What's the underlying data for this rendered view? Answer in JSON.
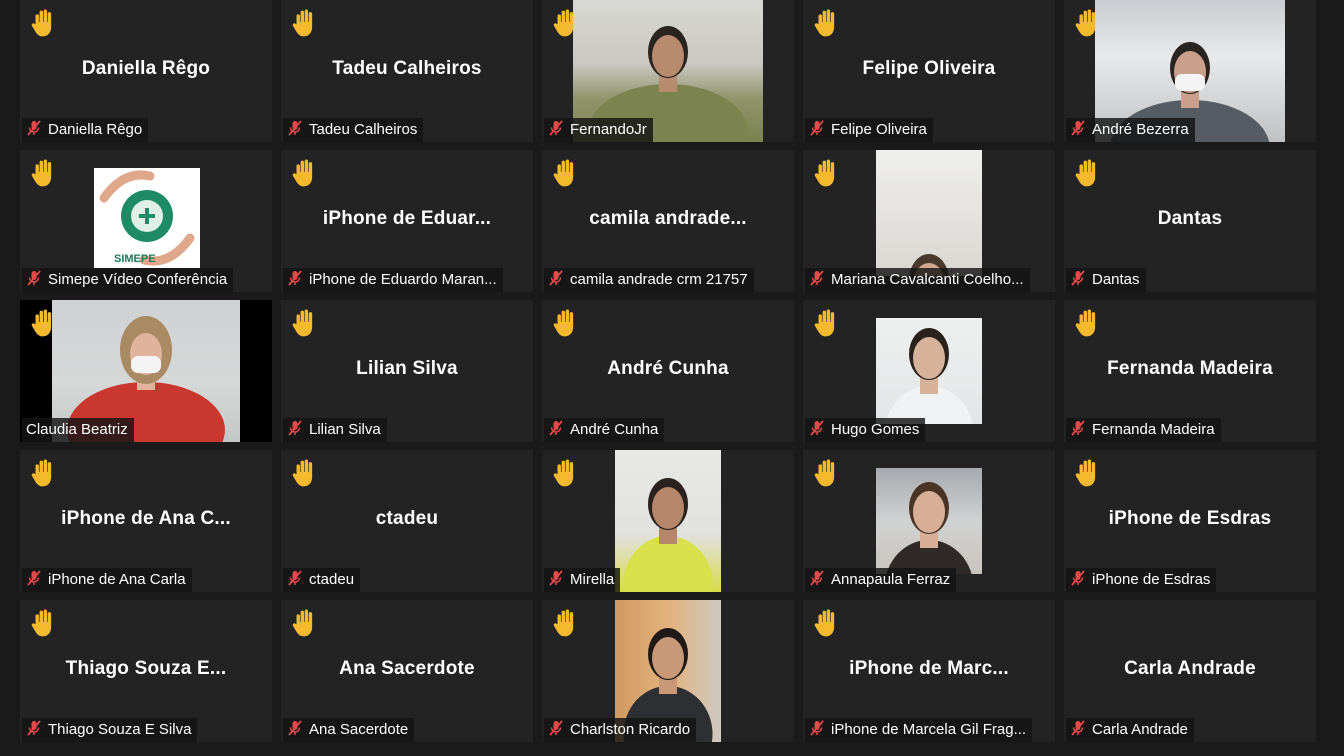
{
  "colors": {
    "tile_bg": "#232323",
    "active_border": "#d3e05a",
    "hand": "#f5b92e",
    "muted_mic": "#e34a4a"
  },
  "participants": [
    {
      "center": "Daniella Rêgo",
      "tag": "Daniella Rêgo",
      "raised_hand": true,
      "muted": true,
      "video": false
    },
    {
      "center": "Tadeu Calheiros",
      "tag": "Tadeu Calheiros",
      "raised_hand": true,
      "muted": true,
      "video": false
    },
    {
      "center": "",
      "tag": "FernandoJr",
      "raised_hand": true,
      "muted": true,
      "video": true
    },
    {
      "center": "Felipe Oliveira",
      "tag": "Felipe Oliveira",
      "raised_hand": true,
      "muted": true,
      "video": false
    },
    {
      "center": "",
      "tag": "André Bezerra",
      "raised_hand": true,
      "muted": true,
      "video": true
    },
    {
      "center": "",
      "tag": "Simepe Vídeo Conferência",
      "raised_hand": true,
      "muted": true,
      "video": true,
      "logo_text": "SIMEPE"
    },
    {
      "center": "iPhone de Eduar...",
      "tag": "iPhone de Eduardo Maran...",
      "raised_hand": true,
      "muted": true,
      "video": false
    },
    {
      "center": "camila andrade...",
      "tag": "camila andrade crm 21757",
      "raised_hand": true,
      "muted": true,
      "video": false
    },
    {
      "center": "",
      "tag": "Mariana Cavalcanti Coelho...",
      "raised_hand": true,
      "muted": true,
      "video": true
    },
    {
      "center": "Dantas",
      "tag": "Dantas",
      "raised_hand": true,
      "muted": true,
      "video": false
    },
    {
      "center": "",
      "tag": "Claudia Beatriz",
      "raised_hand": true,
      "muted": false,
      "video": true,
      "active_speaker": true
    },
    {
      "center": "Lilian Silva",
      "tag": "Lilian Silva",
      "raised_hand": true,
      "muted": true,
      "video": false
    },
    {
      "center": "André Cunha",
      "tag": "André Cunha",
      "raised_hand": true,
      "muted": true,
      "video": false
    },
    {
      "center": "",
      "tag": "Hugo Gomes",
      "raised_hand": true,
      "muted": true,
      "video": true
    },
    {
      "center": "Fernanda Madeira",
      "tag": "Fernanda Madeira",
      "raised_hand": true,
      "muted": true,
      "video": false
    },
    {
      "center": "iPhone de Ana C...",
      "tag": "iPhone de Ana Carla",
      "raised_hand": true,
      "muted": true,
      "video": false
    },
    {
      "center": "ctadeu",
      "tag": "ctadeu",
      "raised_hand": true,
      "muted": true,
      "video": false
    },
    {
      "center": "",
      "tag": "Mirella",
      "raised_hand": true,
      "muted": true,
      "video": true
    },
    {
      "center": "",
      "tag": "Annapaula Ferraz",
      "raised_hand": true,
      "muted": true,
      "video": true
    },
    {
      "center": "iPhone de Esdras",
      "tag": "iPhone de Esdras",
      "raised_hand": true,
      "muted": true,
      "video": false
    },
    {
      "center": "Thiago Souza E...",
      "tag": "Thiago Souza E Silva",
      "raised_hand": true,
      "muted": true,
      "video": false
    },
    {
      "center": "Ana Sacerdote",
      "tag": "Ana Sacerdote",
      "raised_hand": true,
      "muted": true,
      "video": false
    },
    {
      "center": "",
      "tag": "Charlston Ricardo",
      "raised_hand": true,
      "muted": true,
      "video": true
    },
    {
      "center": "iPhone de Marc...",
      "tag": "iPhone de Marcela Gil Frag...",
      "raised_hand": true,
      "muted": true,
      "video": false
    },
    {
      "center": "Carla Andrade",
      "tag": "Carla Andrade",
      "raised_hand": false,
      "muted": true,
      "video": false
    }
  ]
}
